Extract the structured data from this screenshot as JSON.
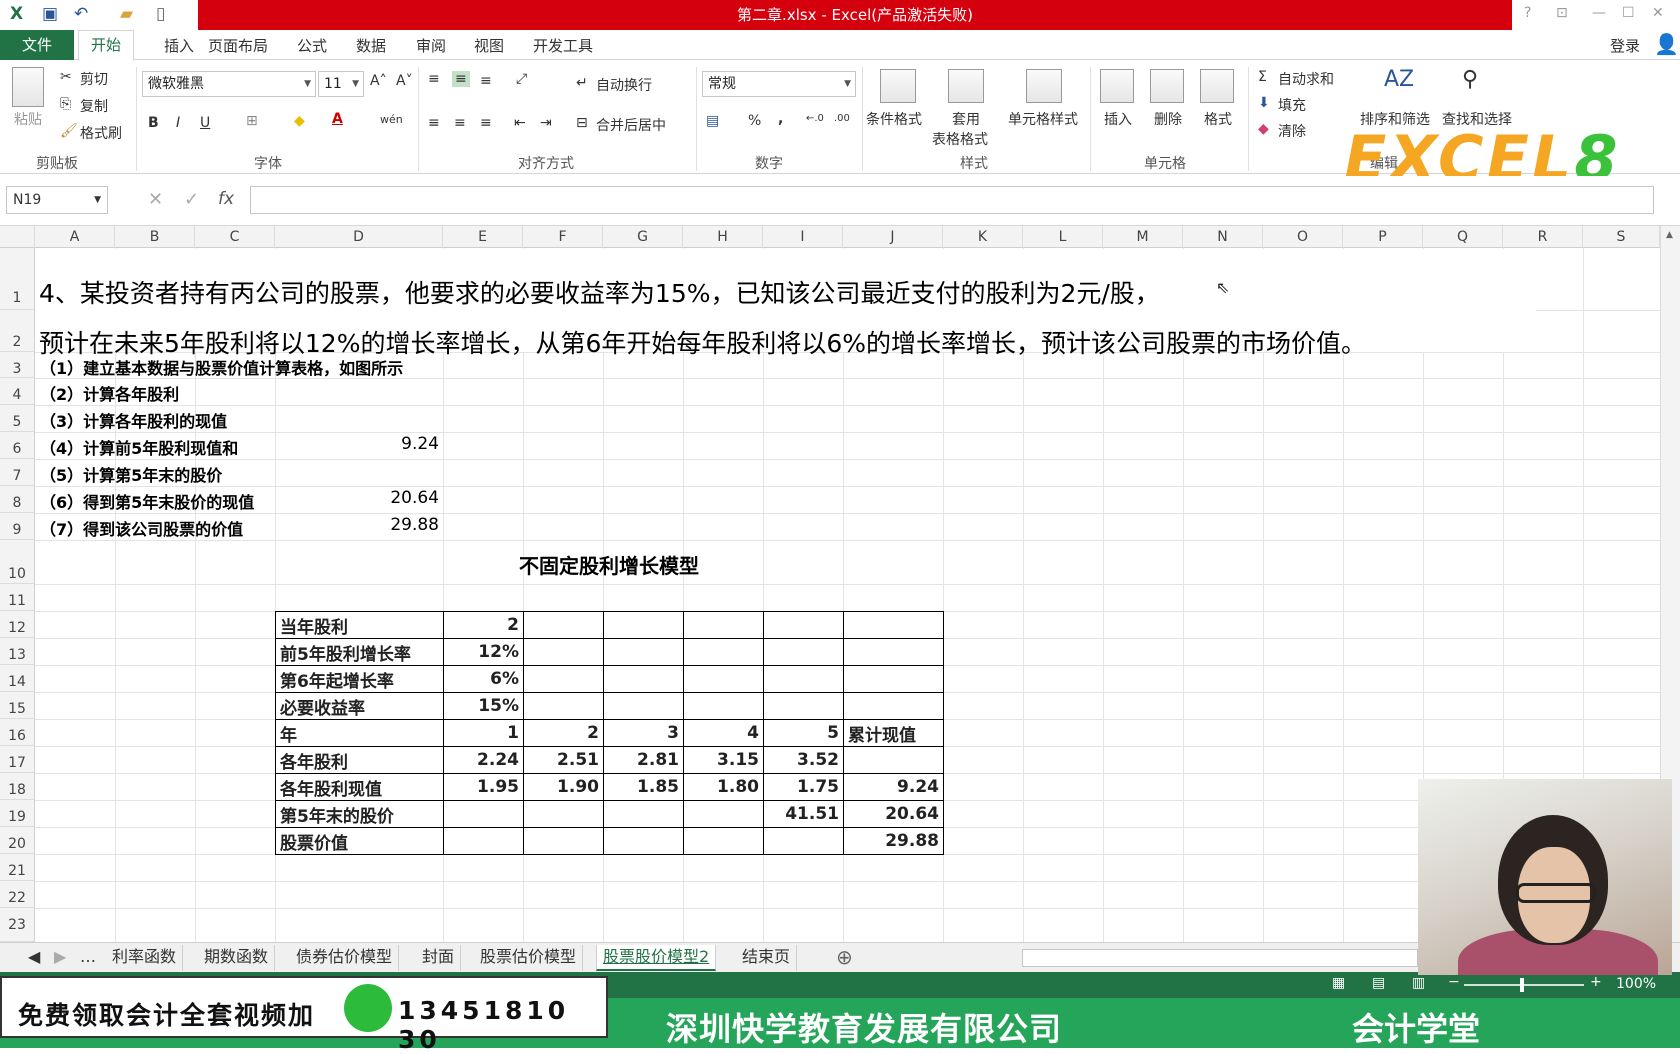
{
  "window": {
    "title": "第二章.xlsx - Excel(产品激活失败)",
    "signin": "登录"
  },
  "menu": {
    "file": "文件",
    "tabs": [
      "开始",
      "插入",
      "页面布局",
      "公式",
      "数据",
      "审阅",
      "视图",
      "开发工具"
    ]
  },
  "ribbon": {
    "clipboard": {
      "paste": "粘贴",
      "cut": "剪切",
      "copy": "复制",
      "format_painter": "格式刷",
      "label": "剪贴板"
    },
    "font": {
      "name": "微软雅黑",
      "size": "11",
      "label": "字体",
      "bold": "B",
      "italic": "I",
      "underline": "U"
    },
    "alignment": {
      "wrap": "自动换行",
      "merge": "合并后居中",
      "label": "对齐方式"
    },
    "number": {
      "format": "常规",
      "percent": "%",
      "comma": ",",
      "label": "数字"
    },
    "styles": {
      "conditional": "条件格式",
      "table_1": "套用",
      "table_2": "表格格式",
      "cell_styles": "单元格样式",
      "label": "样式"
    },
    "cells": {
      "insert": "插入",
      "delete": "删除",
      "format": "格式",
      "label": "单元格"
    },
    "editing": {
      "autosum": "自动求和",
      "fill": "填充",
      "clear": "清除",
      "sort": "排序和筛选",
      "find": "查找和选择",
      "label": "编辑"
    }
  },
  "logo": {
    "part1": "EXCEL",
    "part2": "8"
  },
  "formula_bar": {
    "name_box": "N19",
    "fx": "fx",
    "value": ""
  },
  "columns": [
    "A",
    "B",
    "C",
    "D",
    "E",
    "F",
    "G",
    "H",
    "I",
    "J",
    "K",
    "L",
    "M",
    "N",
    "O",
    "P",
    "Q",
    "R",
    "S"
  ],
  "rows": [
    "1",
    "2",
    "3",
    "4",
    "5",
    "6",
    "7",
    "8",
    "9",
    "10",
    "11",
    "12",
    "13",
    "14",
    "15",
    "16",
    "17",
    "18",
    "19",
    "20",
    "21",
    "22",
    "23"
  ],
  "sheet": {
    "r1": "4、某投资者持有丙公司的股票，他要求的必要收益率为15%，已知该公司最近支付的股利为2元/股，",
    "r2": "预计在未来5年股利将以12%的增长率增长，从第6年开始每年股利将以6%的增长率增长，预计该公司股票的市场价值。",
    "steps": [
      "（1）建立基本数据与股票价值计算表格，如图所示",
      "（2）计算各年股利",
      "（3）计算各年股利的现值",
      "（4）计算前5年股利现值和",
      "（5）计算第5年末的股价",
      "（6）得到第5年末股价的现值",
      "（7）得到该公司股票的价值"
    ],
    "d6": "9.24",
    "d8": "20.64",
    "d9": "29.88",
    "table_title": "不固定股利增长模型"
  },
  "table": {
    "current_dividend": {
      "label": "当年股利",
      "value": "2"
    },
    "growth_first5": {
      "label": "前5年股利增长率",
      "value": "12%"
    },
    "growth_from6": {
      "label": "第6年起增长率",
      "value": "6%"
    },
    "required_return": {
      "label": "必要收益率",
      "value": "15%"
    },
    "year": {
      "label": "年",
      "values": [
        "1",
        "2",
        "3",
        "4",
        "5"
      ],
      "cum_label": "累计现值"
    },
    "dividends": {
      "label": "各年股利",
      "values": [
        "2.24",
        "2.51",
        "2.81",
        "3.15",
        "3.52"
      ]
    },
    "pv": {
      "label": "各年股利现值",
      "values": [
        "1.95",
        "1.90",
        "1.85",
        "1.80",
        "1.75"
      ],
      "cum": "9.24"
    },
    "price5": {
      "label": "第5年末的股价",
      "i": "41.51",
      "j": "20.64"
    },
    "stock_value": {
      "label": "股票价值",
      "j": "29.88"
    }
  },
  "sheet_tabs": [
    "利率函数",
    "期数函数",
    "债券估价模型",
    "封面",
    "股票估价模型",
    "股票股价模型2",
    "结束页"
  ],
  "active_tab": "股票股价模型2",
  "status": {
    "zoom": "100%"
  },
  "promo": {
    "text": "免费领取会计全套视频加",
    "phone": "13451810​30"
  },
  "banner": {
    "company": "深圳快学教育发展有限公司",
    "school": "会计学堂"
  },
  "colors": {
    "excel_green": "#217346",
    "title_red": "#d4000e",
    "banner_green": "#25a55a"
  }
}
